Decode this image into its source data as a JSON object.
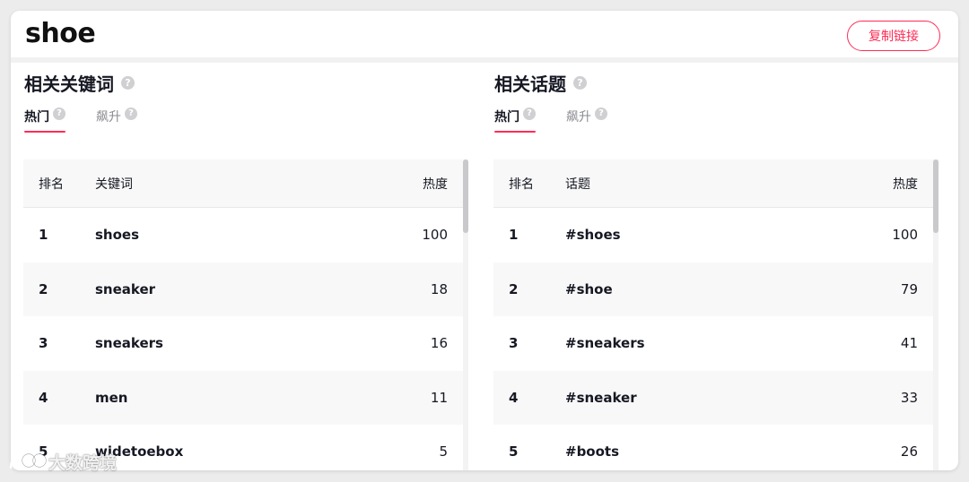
{
  "header": {
    "title": "shoe",
    "copy_link_label": "复制链接"
  },
  "keywords_panel": {
    "title": "相关关键词",
    "tabs": [
      {
        "label": "热门",
        "active": true
      },
      {
        "label": "飙升",
        "active": false
      }
    ],
    "columns": {
      "rank": "排名",
      "name": "关键词",
      "heat": "热度"
    },
    "rows": [
      {
        "rank": "1",
        "name": "shoes",
        "heat": "100"
      },
      {
        "rank": "2",
        "name": "sneaker",
        "heat": "18"
      },
      {
        "rank": "3",
        "name": "sneakers",
        "heat": "16"
      },
      {
        "rank": "4",
        "name": "men",
        "heat": "11"
      },
      {
        "rank": "5",
        "name": "widetoebox",
        "heat": "5"
      }
    ]
  },
  "topics_panel": {
    "title": "相关话题",
    "tabs": [
      {
        "label": "热门",
        "active": true
      },
      {
        "label": "飙升",
        "active": false
      }
    ],
    "columns": {
      "rank": "排名",
      "name": "话题",
      "heat": "热度"
    },
    "rows": [
      {
        "rank": "1",
        "name": "#shoes",
        "heat": "100"
      },
      {
        "rank": "2",
        "name": "#shoe",
        "heat": "79"
      },
      {
        "rank": "3",
        "name": "#sneakers",
        "heat": "41"
      },
      {
        "rank": "4",
        "name": "#sneaker",
        "heat": "33"
      },
      {
        "rank": "5",
        "name": "#boots",
        "heat": "26"
      }
    ]
  },
  "help_icon_glyph": "?",
  "watermark": {
    "text": "大数跨境"
  },
  "colors": {
    "accent": "#fe2c55",
    "text": "#161823",
    "muted": "#8a8b91",
    "stripe": "#f8f8f8"
  },
  "icons": {
    "help": "question-circle-icon",
    "watermark_logo": "watermark-logo-icon"
  }
}
